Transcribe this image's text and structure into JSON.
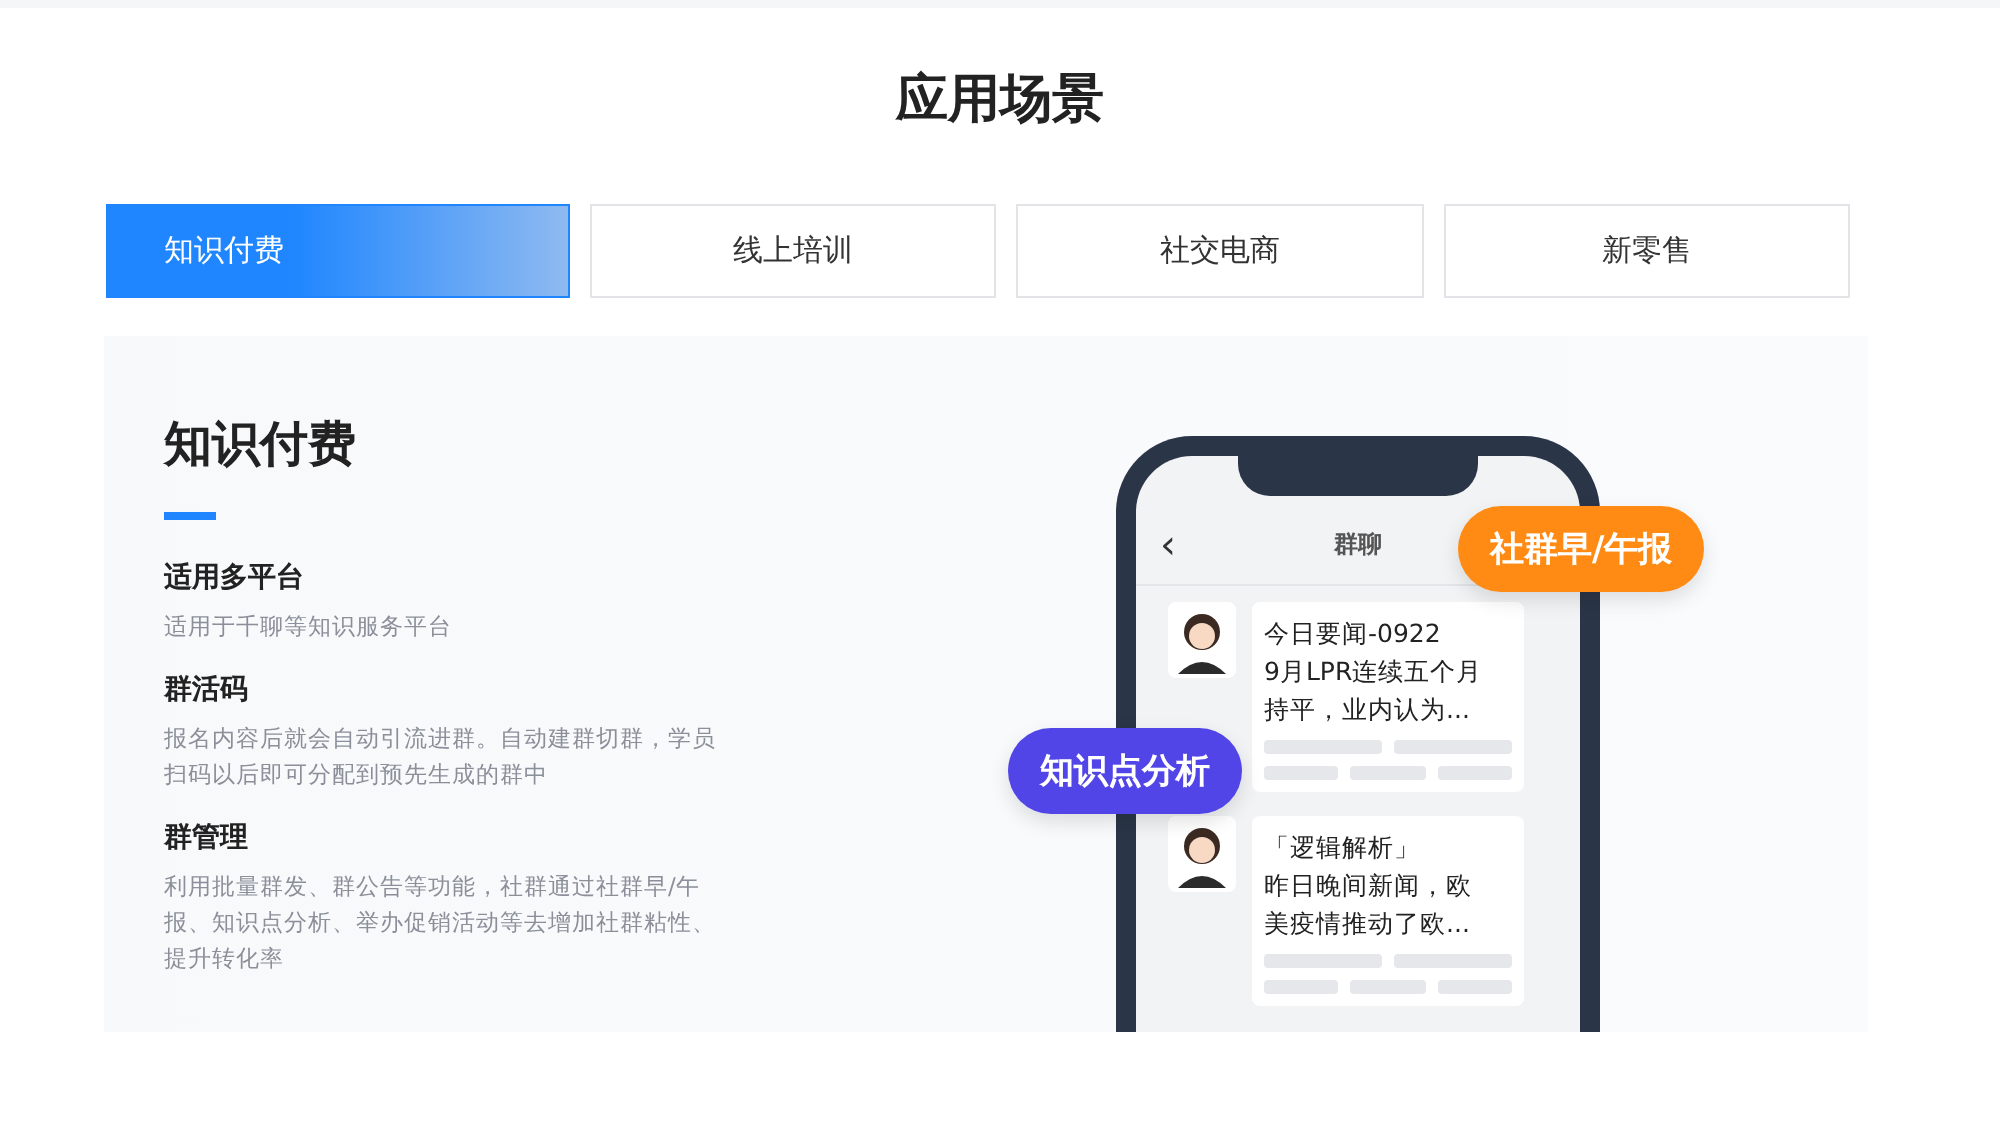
{
  "page_title": "应用场景",
  "tabs": [
    {
      "label": "知识付费",
      "selected": true
    },
    {
      "label": "线上培训",
      "selected": false
    },
    {
      "label": "社交电商",
      "selected": false
    },
    {
      "label": "新零售",
      "selected": false
    }
  ],
  "panel": {
    "title": "知识付费",
    "features": [
      {
        "heading": "适用多平台",
        "text": "适用于千聊等知识服务平台"
      },
      {
        "heading": "群活码",
        "text": "报名内容后就会自动引流进群。自动建群切群，学员扫码以后即可分配到预先生成的群中"
      },
      {
        "heading": "群管理",
        "text": "利用批量群发、群公告等功能，社群通过社群早/午报、知识点分析、举办促销活动等去增加社群粘性、提升转化率"
      }
    ]
  },
  "phone": {
    "back": "‹",
    "chat_title": "群聊",
    "messages": [
      {
        "lines": [
          "今日要闻-0922",
          "9月LPR连续五个月",
          "持平，业内认为..."
        ]
      },
      {
        "lines": [
          "「逻辑解析」",
          "昨日晚间新闻，欧",
          "美疫情推动了欧..."
        ]
      }
    ],
    "callouts": [
      {
        "label": "社群早/午报",
        "color": "#ff8a14"
      },
      {
        "label": "知识点分析",
        "color": "#5145e8"
      }
    ]
  }
}
